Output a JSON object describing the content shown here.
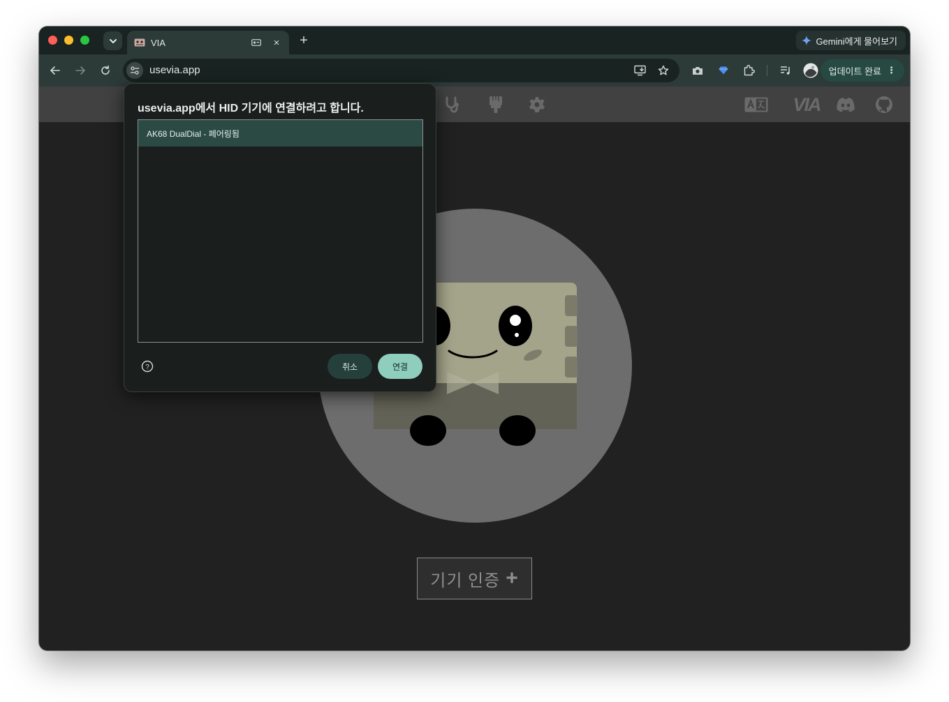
{
  "browser": {
    "tab": {
      "title": "VIA",
      "close": "×"
    },
    "new_tab": "+",
    "gemini_label": "Gemini에게 물어보기",
    "url": "usevia.app",
    "update_label": "업데이트 완료",
    "menu_glyph": "⋮"
  },
  "app": {
    "header_icons": [
      "stethoscope-icon",
      "brush-icon",
      "gear-icon",
      "translate-icon",
      "via-logo",
      "discord-icon",
      "github-icon"
    ],
    "via_logo_text": "VIA",
    "auth_button_label": "기기 인증",
    "auth_button_plus": "+"
  },
  "dialog": {
    "title": "usevia.app에서 HID 기기에 연결하려고 합니다.",
    "devices": [
      "AK68 DualDial - 페어링됨"
    ],
    "selected_index": 0,
    "cancel_label": "취소",
    "connect_label": "연결",
    "help_glyph": "?"
  },
  "colors": {
    "accent": "#8fcdbd",
    "selected_row": "#2b4a44",
    "app_header": "#414141",
    "mascot_body": "#a4a48b"
  }
}
